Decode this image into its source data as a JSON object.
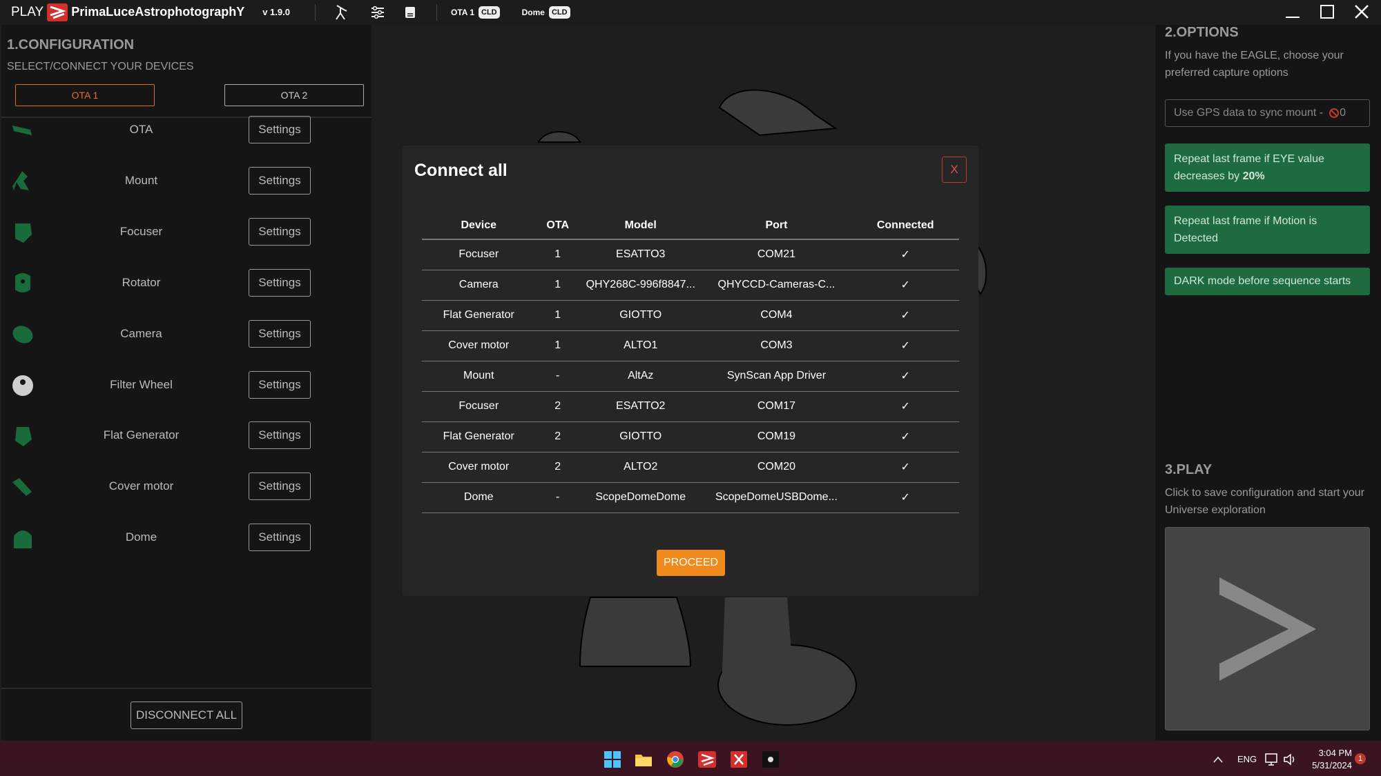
{
  "titlebar": {
    "play": "PLAY",
    "app_name": "PrimaLuceAstrophotographY",
    "version": "v 1.9.0",
    "ota_label": "OTA 1",
    "ota_status": "CLD",
    "dome_label": "Dome",
    "dome_status": "CLD"
  },
  "config": {
    "title": "1.CONFIGURATION",
    "subtitle": "SELECT/CONNECT YOUR DEVICES",
    "tabs": [
      {
        "label": "OTA 1",
        "active": true
      },
      {
        "label": "OTA 2",
        "active": false
      }
    ],
    "devices": [
      {
        "name": "OTA",
        "icon": "ota-icon",
        "button": "Settings"
      },
      {
        "name": "Mount",
        "icon": "mount-icon",
        "button": "Settings"
      },
      {
        "name": "Focuser",
        "icon": "focuser-icon",
        "button": "Settings"
      },
      {
        "name": "Rotator",
        "icon": "rotator-icon",
        "button": "Settings"
      },
      {
        "name": "Camera",
        "icon": "camera-icon",
        "button": "Settings"
      },
      {
        "name": "Filter Wheel",
        "icon": "filter-wheel-icon",
        "button": "Settings"
      },
      {
        "name": "Flat Generator",
        "icon": "flat-generator-icon",
        "button": "Settings"
      },
      {
        "name": "Cover motor",
        "icon": "cover-motor-icon",
        "button": "Settings"
      },
      {
        "name": "Dome",
        "icon": "dome-icon",
        "button": "Settings"
      }
    ],
    "disconnect_label": "DISCONNECT ALL"
  },
  "modal": {
    "title": "Connect all",
    "close_label": "X",
    "columns": [
      "Device",
      "OTA",
      "Model",
      "Port",
      "Connected"
    ],
    "rows": [
      [
        "Focuser",
        "1",
        "ESATTO3",
        "COM21",
        "✓"
      ],
      [
        "Camera",
        "1",
        "QHY268C-996f8847...",
        "QHYCCD-Cameras-C...",
        "✓"
      ],
      [
        "Flat Generator",
        "1",
        "GIOTTO",
        "COM4",
        "✓"
      ],
      [
        "Cover motor",
        "1",
        "ALTO1",
        "COM3",
        "✓"
      ],
      [
        "Mount",
        "-",
        "AltAz",
        "SynScan App Driver",
        "✓"
      ],
      [
        "Focuser",
        "2",
        "ESATTO2",
        "COM17",
        "✓"
      ],
      [
        "Flat Generator",
        "2",
        "GIOTTO",
        "COM19",
        "✓"
      ],
      [
        "Cover motor",
        "2",
        "ALTO2",
        "COM20",
        "✓"
      ],
      [
        "Dome",
        "-",
        "ScopeDomeDome",
        "ScopeDomeUSBDome...",
        "✓"
      ]
    ],
    "proceed_label": "PROCEED"
  },
  "options": {
    "title": "2.OPTIONS",
    "subtitle": "If you have the EAGLE, choose your preferred capture options",
    "gps_label": "Use GPS data to sync mount  -",
    "gps_value": "0",
    "repeat_eye_prefix": "Repeat last frame if EYE value decreases by ",
    "repeat_eye_value": "20%",
    "repeat_motion": "Repeat last frame if Motion is Detected",
    "dark_mode": "DARK mode before sequence starts"
  },
  "play": {
    "title": "3.PLAY",
    "subtitle": "Click to save configuration and start your Universe exploration"
  },
  "taskbar": {
    "lang": "ENG",
    "time": "3:04 PM",
    "date": "5/31/2024",
    "notification_count": "1"
  },
  "colors": {
    "accent": "#f08a1c",
    "success": "#2ec27e",
    "option_green": "#1e6b3f",
    "taskbar": "#3a1420"
  }
}
